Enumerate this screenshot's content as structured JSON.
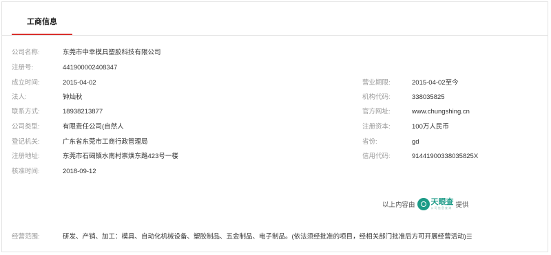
{
  "tab": {
    "label": "工商信息"
  },
  "left_fields": [
    {
      "label": "公司名称:",
      "value": "东莞市中幸模具塑胶科技有限公司"
    },
    {
      "label": "注册号:",
      "value": "441900002408347"
    },
    {
      "label": "成立时间:",
      "value": "2015-04-02"
    },
    {
      "label": "法人:",
      "value": "钟灿秋"
    },
    {
      "label": "联系方式:",
      "value": "18938213877"
    },
    {
      "label": "公司类型:",
      "value": "有限责任公司(自然人"
    },
    {
      "label": "登记机关:",
      "value": "广东省东莞市工商行政管理局"
    },
    {
      "label": "注册地址:",
      "value": "东莞市石碣镇水南村崇焕东路423号一楼"
    },
    {
      "label": "核准时间:",
      "value": "2018-09-12"
    }
  ],
  "right_fields": [
    {
      "label": "营业期限:",
      "value": "2015-04-02至今"
    },
    {
      "label": "机构代码:",
      "value": "338035825"
    },
    {
      "label": "官方网址:",
      "value": "www.chungshing.cn"
    },
    {
      "label": "注册资本:",
      "value": "100万人民币"
    },
    {
      "label": "省份:",
      "value": "gd"
    },
    {
      "label": "信用代码:",
      "value": "91441900338035825X"
    }
  ],
  "provider": {
    "prefix": "以上内容由",
    "logo_name": "天眼查",
    "logo_sub": "公 司 信 息 查 询",
    "suffix": "提供",
    "brand_color": "#1c9b87"
  },
  "scope": {
    "label": "经营范围:",
    "value": "研发、产销、加工：模具、自动化机械设备、塑胶制品、五金制品、电子制品。(依法须经批准的项目，经相关部门批准后方可开展经营活动)☰"
  },
  "colors": {
    "accent": "#d9302c",
    "label": "#9a9a9a",
    "text": "#333333"
  }
}
